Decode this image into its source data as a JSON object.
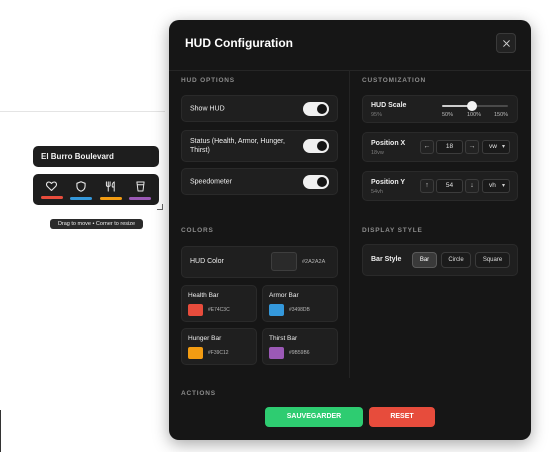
{
  "preview": {
    "street_name": "El Burro Boulevard",
    "icons": [
      {
        "icon": "heart-icon",
        "color": "#E74C3C"
      },
      {
        "icon": "shield-icon",
        "color": "#3498DB"
      },
      {
        "icon": "fork-knife-icon",
        "color": "#F39C12"
      },
      {
        "icon": "cup-icon",
        "color": "#9B59B6"
      }
    ],
    "drag_hint": "Drag to move • Corner to resize"
  },
  "panel": {
    "title": "HUD Configuration",
    "close_icon": "close-icon"
  },
  "hud_options": {
    "heading": "HUD OPTIONS",
    "items": [
      {
        "label": "Show HUD",
        "enabled": true
      },
      {
        "label": "Status (Health, Armor, Hunger, Thirst)",
        "enabled": true
      },
      {
        "label": "Speedometer",
        "enabled": true
      }
    ]
  },
  "customization": {
    "heading": "CUSTOMIZATION",
    "scale": {
      "label": "HUD Scale",
      "value_text": "95%",
      "value": 95,
      "min": 50,
      "max": 150,
      "ticks": [
        "50%",
        "100%",
        "150%"
      ]
    },
    "position_x": {
      "label": "Position X",
      "sub": "18vw",
      "dec": "←",
      "inc": "→",
      "value": "18",
      "unit": "vw"
    },
    "position_y": {
      "label": "Position Y",
      "sub": "54vh",
      "dec": "↑",
      "inc": "↓",
      "value": "54",
      "unit": "vh"
    }
  },
  "colors": {
    "heading": "COLORS",
    "hud_color": {
      "label": "HUD Color",
      "hex": "#2A2A2A"
    },
    "bars": [
      {
        "label": "Health Bar",
        "hex": "#E74C3C"
      },
      {
        "label": "Armor Bar",
        "hex": "#3498DB"
      },
      {
        "label": "Hunger Bar",
        "hex": "#F39C12"
      },
      {
        "label": "Thirst Bar",
        "hex": "#9B59B6"
      }
    ]
  },
  "display_style": {
    "heading": "DISPLAY STYLE",
    "label": "Bar Style",
    "options": [
      "Bar",
      "Circle",
      "Square"
    ],
    "selected": "Bar"
  },
  "actions": {
    "heading": "ACTIONS",
    "save_label": "SAUVEGARDER",
    "save_color": "#2ECC71",
    "reset_label": "RESET",
    "reset_color": "#E74C3C"
  }
}
